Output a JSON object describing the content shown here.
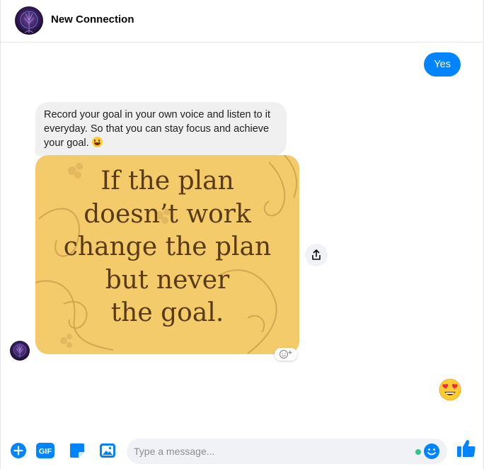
{
  "header": {
    "contact_name": "New Connection",
    "avatar_icon": "tree-of-life-avatar-icon"
  },
  "messages": {
    "outgoing_text": "Yes",
    "incoming_text": "Record your goal in your own voice and listen to it everyday. So that you can stay focus and achieve your goal.",
    "incoming_emoji": "grinning-face-emoji",
    "image_quote_lines": [
      "If the plan",
      "doesn’t work",
      "change the plan",
      "but never",
      "the goal."
    ],
    "outgoing_reaction": "heart-eyes-emoji"
  },
  "composer": {
    "placeholder": "Type a message...",
    "value": "",
    "tools": [
      "add-icon",
      "gif-icon",
      "sticker-icon",
      "photo-icon"
    ],
    "gif_label": "GIF"
  },
  "colors": {
    "accent": "#0084ff",
    "image_background": "#f3cb6a",
    "quote_text": "#5a3a12",
    "incoming_bubble": "#f0f0f0",
    "active_dot": "#31c48d"
  }
}
